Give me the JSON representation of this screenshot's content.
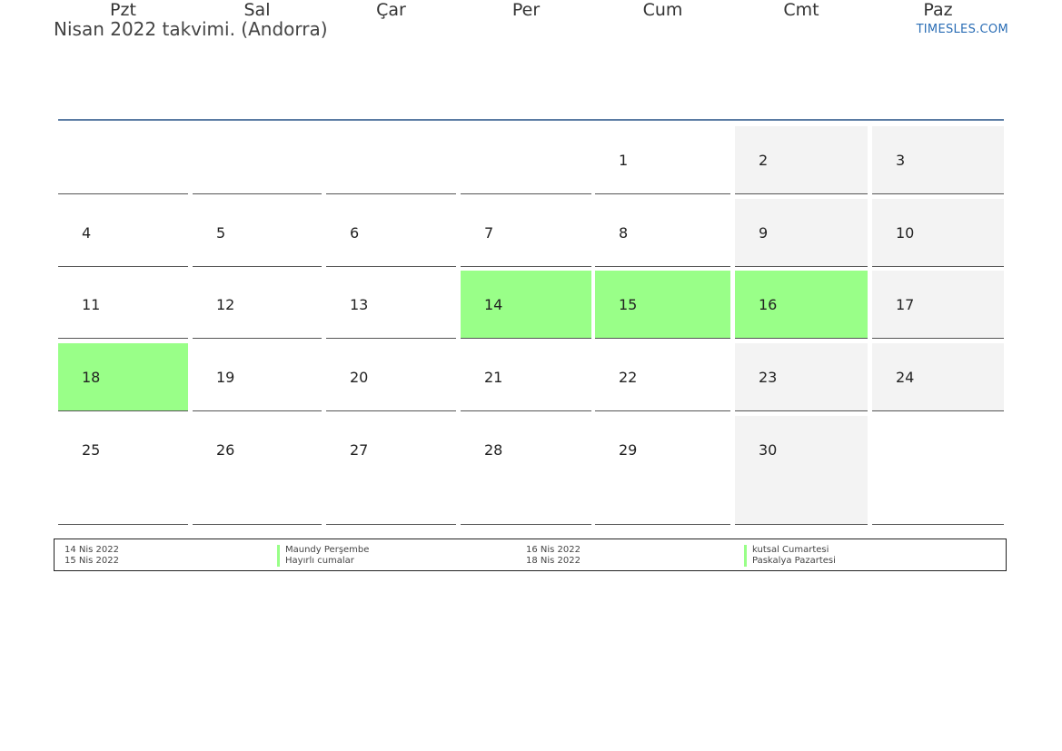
{
  "title": "Nisan 2022 takvimi. (Andorra)",
  "brand": "TIMESLES.COM",
  "colors": {
    "holiday": "#99ff88",
    "weekend": "#f3f3f3",
    "header_line": "#5a7ba3",
    "brand": "#2a6db5"
  },
  "weekdays": [
    "Pzt",
    "Sal",
    "Çar",
    "Per",
    "Cum",
    "Cmt",
    "Paz"
  ],
  "weeks": [
    [
      "",
      "",
      "",
      "",
      "1",
      "2",
      "3"
    ],
    [
      "4",
      "5",
      "6",
      "7",
      "8",
      "9",
      "10"
    ],
    [
      "11",
      "12",
      "13",
      "14",
      "15",
      "16",
      "17"
    ],
    [
      "18",
      "19",
      "20",
      "21",
      "22",
      "23",
      "24"
    ],
    [
      "25",
      "26",
      "27",
      "28",
      "29",
      "30",
      ""
    ]
  ],
  "holiday_days": [
    "14",
    "15",
    "16",
    "18"
  ],
  "legend": [
    {
      "date": "14 Nis 2022",
      "name": "Maundy Perşembe"
    },
    {
      "date": "15 Nis 2022",
      "name": "Hayırlı cumalar"
    },
    {
      "date": "16 Nis 2022",
      "name": "kutsal Cumartesi"
    },
    {
      "date": "18 Nis 2022",
      "name": "Paskalya Pazartesi"
    }
  ]
}
